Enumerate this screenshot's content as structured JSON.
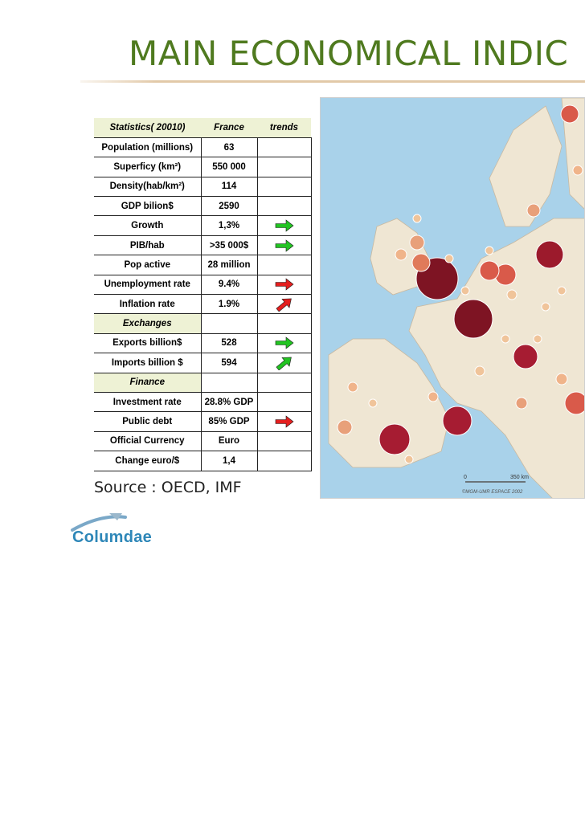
{
  "title": "MAIN ECONOMICAL INDIC",
  "table": {
    "header": {
      "stat": "Statistics( 20010)",
      "country": "France",
      "trends": "trends"
    },
    "rows": [
      {
        "label": "Population (millions)",
        "value": "63",
        "trend": ""
      },
      {
        "label": "Superficy (km²)",
        "value": "550 000",
        "trend": ""
      },
      {
        "label": "Density(hab/km²)",
        "value": "114",
        "trend": ""
      },
      {
        "label": "GDP bilion$",
        "value": "2590",
        "trend": ""
      },
      {
        "label": "Growth",
        "value": "1,3%",
        "trend": "green-right"
      },
      {
        "label": "PIB/hab",
        "value": ">35 000$",
        "trend": "green-right"
      },
      {
        "label": "Pop active",
        "value": "28 million",
        "trend": ""
      },
      {
        "label": "Unemployment rate",
        "value": "9.4%",
        "trend": "red-right"
      },
      {
        "label": "Inflation rate",
        "value": "1.9%",
        "trend": "red-up"
      }
    ],
    "section_exchanges": "Exchanges",
    "exchanges": [
      {
        "label": "Exports billion$",
        "value": "528",
        "trend": "green-right"
      },
      {
        "label": "Imports billion $",
        "value": "594",
        "trend": "green-up"
      }
    ],
    "section_finance": "Finance",
    "finance": [
      {
        "label": "Investment rate",
        "value": "28.8% GDP",
        "trend": ""
      },
      {
        "label": "Public debt",
        "value": "85% GDP",
        "trend": "red-right"
      },
      {
        "label": "Official Currency",
        "value": "Euro",
        "trend": ""
      },
      {
        "label": "Change euro/$",
        "value": "1,4",
        "trend": ""
      }
    ]
  },
  "source": "Source : OECD, IMF",
  "logo": "Columdae",
  "map": {
    "scale_label": "350 km",
    "scale_zero": "0",
    "credit": "©MGM-UMR ESPACE 2002"
  },
  "colors": {
    "title": "#4f7a1f",
    "green_arrow": "#22c422",
    "red_arrow": "#e41f1f",
    "header_bg": "#eef2d5",
    "logo": "#2e87b8"
  }
}
